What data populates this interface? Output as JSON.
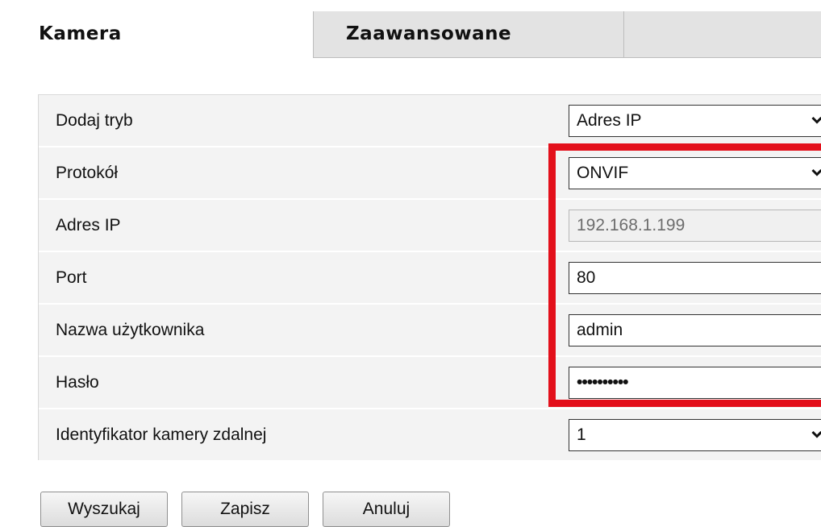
{
  "tabs": [
    {
      "label": "Kamera",
      "active": true
    },
    {
      "label": "Zaawansowane",
      "active": false
    }
  ],
  "form": {
    "rows": [
      {
        "label": "Dodaj tryb",
        "value": "Adres IP",
        "type": "select"
      },
      {
        "label": "Protokół",
        "value": "ONVIF",
        "type": "select"
      },
      {
        "label": "Adres IP",
        "value": "192.168.1.199",
        "type": "text-disabled"
      },
      {
        "label": "Port",
        "value": "80",
        "type": "text"
      },
      {
        "label": "Nazwa użytkownika",
        "value": "admin",
        "type": "text"
      },
      {
        "label": "Hasło",
        "value": "••••••••••",
        "type": "password"
      },
      {
        "label": "Identyfikator kamery zdalnej",
        "value": "1",
        "type": "select"
      }
    ]
  },
  "buttons": {
    "search": "Wyszukaj",
    "save": "Zapisz",
    "cancel": "Anuluj"
  },
  "colors": {
    "highlight": "#e3101b",
    "tab_inactive_bg": "#e3e3e3",
    "row_bg": "#f3f3f3"
  }
}
